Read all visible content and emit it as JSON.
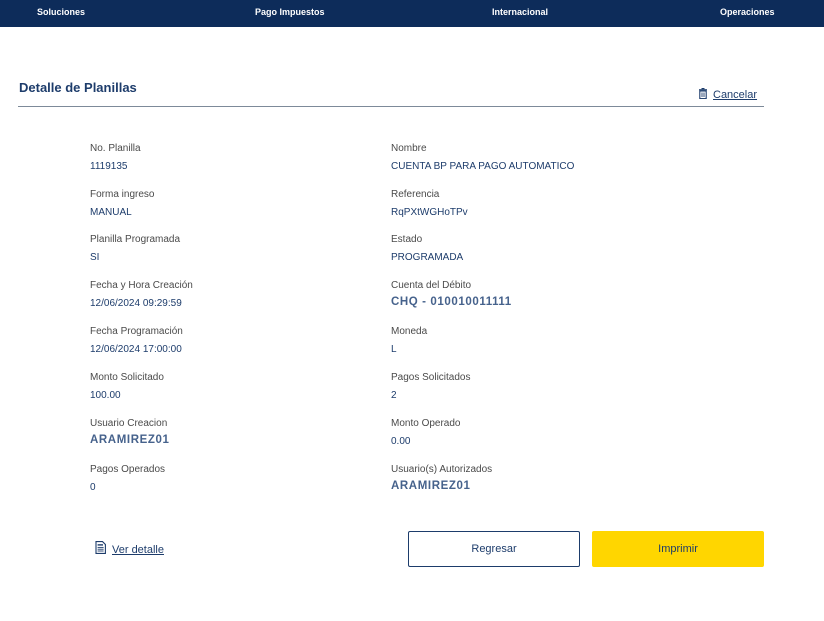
{
  "nav": {
    "items": [
      "Soluciones",
      "Pago Impuestos",
      "Internacional",
      "Operaciones"
    ]
  },
  "header": {
    "title": "Detalle de Planillas",
    "cancel_label": "Cancelar",
    "cancel_icon": "trash-icon"
  },
  "details": {
    "left": [
      {
        "label": "No. Planilla",
        "value": "1119135"
      },
      {
        "label": "Forma ingreso",
        "value": "MANUAL"
      },
      {
        "label": "Planilla Programada",
        "value": "SI"
      },
      {
        "label": "Fecha y Hora Creación",
        "value": "12/06/2024 09:29:59"
      },
      {
        "label": "Fecha Programación",
        "value": "12/06/2024 17:00:00"
      },
      {
        "label": "Monto Solicitado",
        "value": "100.00"
      },
      {
        "label": "Usuario Creacion",
        "value": "ARAMIREZ01"
      },
      {
        "label": "Pagos Operados",
        "value": "0"
      }
    ],
    "right": [
      {
        "label": "Nombre",
        "value": "CUENTA BP PARA PAGO AUTOMATICO"
      },
      {
        "label": "Referencia",
        "value": "RqPXtWGHoTPv"
      },
      {
        "label": "Estado",
        "value": "PROGRAMADA"
      },
      {
        "label": "Cuenta del Débito",
        "value": "CHQ - 010010011111"
      },
      {
        "label": "Moneda",
        "value": "L"
      },
      {
        "label": "Pagos Solicitados",
        "value": "2"
      },
      {
        "label": "Monto Operado",
        "value": "0.00"
      },
      {
        "label": "Usuario(s) Autorizados",
        "value": "ARAMIREZ01"
      }
    ]
  },
  "actions": {
    "detail_label": "Ver detalle",
    "detail_icon": "document-icon",
    "back_label": "Regresar",
    "print_label": "Imprimir"
  },
  "colors": {
    "nav_bg": "#0d2c5a",
    "primary_text": "#1d3c6b",
    "print_button": "#ffd600"
  }
}
